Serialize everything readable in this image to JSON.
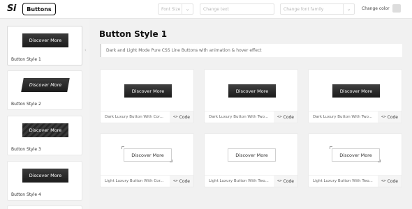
{
  "header": {
    "logo_text": "Si",
    "brand_label": "Buttons",
    "font_size_placeholder": "Font Size",
    "change_text_placeholder": "Change text",
    "font_family_placeholder": "Change font family",
    "change_color_label": "Change color",
    "chevron": "⌄"
  },
  "sidebar": {
    "collapse_glyph": "‹",
    "items": [
      {
        "label": "Button Style 1",
        "preview": "Discover More"
      },
      {
        "label": "Button Style 2",
        "preview": "Discover More"
      },
      {
        "label": "Button Style 3",
        "preview": "Discover More"
      },
      {
        "label": "Button Style 4",
        "preview": "Discover More"
      }
    ]
  },
  "main": {
    "title": "Button Style 1",
    "description": "Dark and Light Mode Pure CSS Line Buttons with animation & hover effect",
    "code_label": "Code",
    "code_icon": "<>",
    "cards": [
      {
        "button": "Discover More",
        "title": "Dark Luxury Button With Cor..."
      },
      {
        "button": "Discover More",
        "title": "Dark Luxury Button With Two..."
      },
      {
        "button": "Discover More",
        "title": "Dark Luxury Button With Two..."
      },
      {
        "button": "Discover More",
        "title": "Light Luxury Button With Cor..."
      },
      {
        "button": "Discover More",
        "title": "Light Luxury Button With Two..."
      },
      {
        "button": "Discover More",
        "title": "Light Luxury Button With Two..."
      }
    ]
  },
  "colors": {
    "accent_dark": "#1c1c1c",
    "swatch": "#dddddd"
  }
}
